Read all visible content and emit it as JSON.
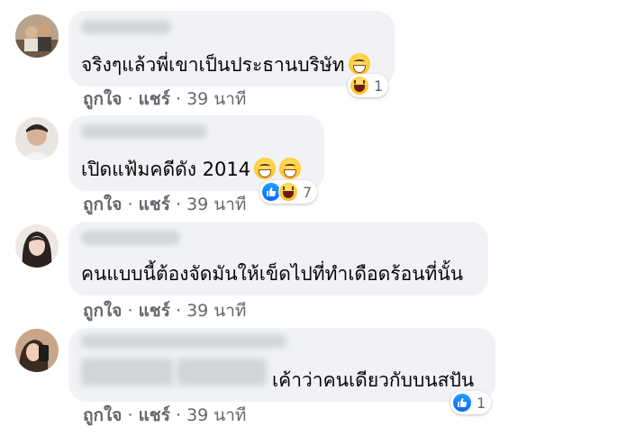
{
  "comments": [
    {
      "text": "จริงๆแล้วพี่เขาเป็นประธานบริษัท",
      "like_label": "ถูกใจ",
      "separator": "·",
      "reply_label": "แชร์",
      "time": "39 นาที",
      "reaction_icons": [
        "haha-reaction-icon"
      ],
      "reaction_count": "1"
    },
    {
      "text": "เปิดแฟ้มคดีดัง 2014",
      "like_label": "ถูกใจ",
      "separator": "·",
      "reply_label": "แชร์",
      "time": "39 นาที",
      "reaction_icons": [
        "like-reaction-icon",
        "haha-reaction-icon"
      ],
      "reaction_count": "7"
    },
    {
      "text": "คนแบบนี้ต้องจัดมันให้เข็ดไปที่ทำเดือดร้อนที่นั้น",
      "like_label": "ถูกใจ",
      "separator": "·",
      "reply_label": "แชร์",
      "time": "39 นาที",
      "reaction_icons": [],
      "reaction_count": ""
    },
    {
      "text": "เค้าว่าคนเดียวกับบนสปัน",
      "like_label": "ถูกใจ",
      "separator": "·",
      "reply_label": "แชร์",
      "time": "39 นาที",
      "reaction_icons": [
        "like-reaction-icon"
      ],
      "reaction_count": "1"
    }
  ],
  "colors": {
    "bubble": "#f0f2f5",
    "meta_text": "#65676b",
    "like_blue": "#0866ff"
  }
}
